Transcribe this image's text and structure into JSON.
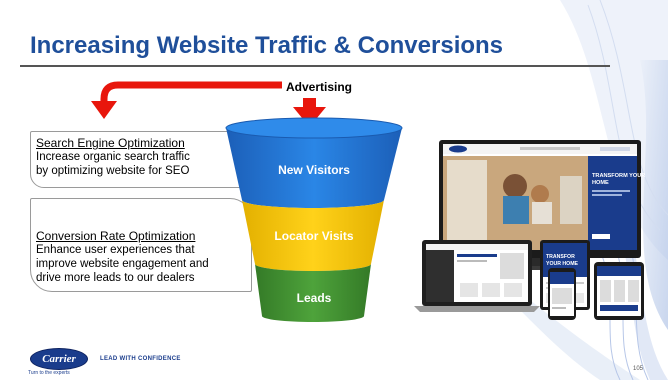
{
  "slide": {
    "title": "Increasing Website Traffic & Conversions",
    "advertising_label": "Advertising",
    "boxes": [
      {
        "heading": "Search Engine Optimization",
        "line1": "Increase organic search traffic",
        "line2": "by optimizing website for SEO"
      },
      {
        "heading": "Conversion Rate Optimization",
        "line1": "Enhance user experiences that",
        "line2": "improve website engagement and",
        "line3": "drive more leads to our dealers"
      }
    ],
    "funnel": {
      "stage1": "New Visitors",
      "stage2": "Locator Visits",
      "stage3": "Leads"
    },
    "mockup": {
      "desktop_headline_1": "TRANSFORM YOUR",
      "desktop_headline_2": "HOME",
      "tablet_headline_1": "TRANSFOR",
      "tablet_headline_2": "YOUR HOME",
      "brand": "Carrier"
    },
    "footer": {
      "logo": "Carrier",
      "tagline": "Turn to the experts",
      "slogan": "LEAD WITH CONFIDENCE",
      "page_number": "105"
    }
  },
  "colors": {
    "title": "#1f4f9a",
    "funnel_blue": "#1e6fd0",
    "funnel_yellow": "#f5c400",
    "funnel_green": "#3f8d2f",
    "arrow_red": "#e8160c",
    "brand_navy": "#1a3c8c"
  }
}
